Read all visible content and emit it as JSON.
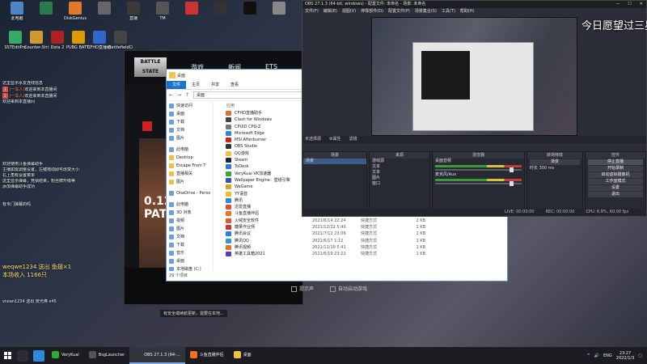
{
  "desktop_icons": [
    {
      "label": "此电脑",
      "color": "#4a86c8"
    },
    {
      "label": "",
      "color": "#2c7a4a"
    },
    {
      "label": "DiskGenius",
      "color": "#e07a2a"
    },
    {
      "label": "",
      "color": "#666"
    },
    {
      "label": "直播",
      "color": "#3a3a3a"
    },
    {
      "label": "TM",
      "color": "#555"
    },
    {
      "label": "",
      "color": "#c33"
    },
    {
      "label": "",
      "color": "#333"
    },
    {
      "label": "",
      "color": "#111"
    },
    {
      "label": "",
      "color": "#888"
    }
  ],
  "desktop_icons_row2": [
    {
      "label": "SSTEditPro",
      "color": "#3a6"
    },
    {
      "label": "Counter-Strike Global",
      "color": "#c93"
    },
    {
      "label": "Dota 2",
      "color": "#a22"
    },
    {
      "label": "PUBG BATTLEGR...",
      "color": "#d90"
    },
    {
      "label": "CFHD直播助手",
      "color": "#36c"
    },
    {
      "label": "BattlefieldCiv",
      "color": "#444"
    }
  ],
  "chat": {
    "top_lines": [
      {
        "badge": "",
        "name": "",
        "text": "这里显示水友连线信息"
      },
      {
        "badge": "3",
        "name": "(一车人)",
        "text": "欢迎来到本直播间"
      },
      {
        "badge": "2",
        "name": "(一车人)",
        "text": "欢迎来到本直播间"
      },
      {
        "badge": "",
        "name": "",
        "text": "欢迎来到本直播间"
      }
    ],
    "mid_lines": [
      "欢迎使用斗鱼弹幕助手",
      "主播如需调整设置，左键拖动即可改变大小",
      "右上角有设置菜单",
      "这里显示弹幕，竞猜结果，粉丝牌升级等",
      "添加弹幕助手成功"
    ],
    "mid_tail": "有专门弹幕的吗",
    "gift_lines": [
      "weqwe1234 送出 鱼翅×1",
      "本场收入 1166只"
    ],
    "bottom_lines": [
      "vivian1234 送出 荧光棒 x45"
    ]
  },
  "game": {
    "logo": "BATTLE STATE",
    "nav": [
      "游戏",
      "新闻",
      "ETS"
    ],
    "art_text": "0.12 PATC",
    "footer": [
      "提示声",
      "自动启动游戏"
    ]
  },
  "explorer": {
    "title": "桌面",
    "ribbon": [
      "文件",
      "主页",
      "共享",
      "查看"
    ],
    "address": "桌面",
    "sidebar": [
      {
        "label": "快速访问",
        "y": false
      },
      {
        "label": "桌面",
        "y": false
      },
      {
        "label": "下载",
        "y": false
      },
      {
        "label": "文档",
        "y": false
      },
      {
        "label": "图片",
        "y": false
      },
      {
        "label": "此电脑",
        "y": false
      },
      {
        "label": "Desktop",
        "y": true
      },
      {
        "label": "Escape From T",
        "y": true
      },
      {
        "label": "直播相关",
        "y": true
      },
      {
        "label": "图片",
        "y": true
      },
      {
        "label": "OneDrive - Perso",
        "y": false
      },
      {
        "label": "此电脑",
        "y": false
      },
      {
        "label": "3D 对象",
        "y": false
      },
      {
        "label": "视频",
        "y": false
      },
      {
        "label": "图片",
        "y": false
      },
      {
        "label": "文档",
        "y": false
      },
      {
        "label": "下载",
        "y": false
      },
      {
        "label": "音乐",
        "y": false
      },
      {
        "label": "桌面",
        "y": false
      },
      {
        "label": "本地磁盘 (C:)",
        "y": false
      },
      {
        "label": "本地磁盘 (D:)",
        "y": false
      }
    ],
    "list_header": "应用",
    "files": [
      {
        "name": "CFHD直播助手",
        "date": "",
        "type": "",
        "size": "",
        "color": "#e07030"
      },
      {
        "name": "Clash for Windows",
        "date": "",
        "type": "",
        "size": "",
        "color": "#444"
      },
      {
        "name": "CPUID CPU-Z",
        "date": "",
        "type": "",
        "size": "",
        "color": "#777"
      },
      {
        "name": "Microsoft Edge",
        "date": "",
        "type": "",
        "size": "",
        "color": "#2a8ae0"
      },
      {
        "name": "MSI Afterburner",
        "date": "",
        "type": "",
        "size": "",
        "color": "#c22"
      },
      {
        "name": "OBS Studio",
        "date": "",
        "type": "",
        "size": "",
        "color": "#333"
      },
      {
        "name": "QQ游戏",
        "date": "",
        "type": "",
        "size": "",
        "color": "#f0c040"
      },
      {
        "name": "Steam",
        "date": "",
        "type": "",
        "size": "",
        "color": "#1b2838"
      },
      {
        "name": "ToDesk",
        "date": "",
        "type": "",
        "size": "",
        "color": "#2a7ae0"
      },
      {
        "name": "VeryKuai VK加速器",
        "date": "",
        "type": "",
        "size": "",
        "color": "#3a3"
      },
      {
        "name": "Wallpaper Engine：壁纸引擎",
        "date": "",
        "type": "",
        "size": "",
        "color": "#2a5ab0"
      },
      {
        "name": "WeGame",
        "date": "",
        "type": "",
        "size": "",
        "color": "#e0a020"
      },
      {
        "name": "YY语音",
        "date": "",
        "type": "",
        "size": "",
        "color": "#f0c020"
      },
      {
        "name": "腾讯",
        "date": "",
        "type": "",
        "size": "",
        "color": "#2a8ae0"
      },
      {
        "name": "迅雷直播",
        "date": "2021/6/13 23:27",
        "type": "快捷方式",
        "size": "2 KB",
        "color": "#e05030"
      },
      {
        "name": "斗鱼直播伴侣",
        "date": "2021/12/22 23:11",
        "type": "快捷方式",
        "size": "1 KB",
        "color": "#f07020"
      },
      {
        "name": "火绒安全软件",
        "date": "2021/6/14 22:24",
        "type": "快捷方式",
        "size": "2 KB",
        "color": "#e05a30"
      },
      {
        "name": "糖果作业师",
        "date": "2021/12/22 5:40",
        "type": "快捷方式",
        "size": "1 KB",
        "color": "#c33"
      },
      {
        "name": "腾讯会议",
        "date": "2021/7/12 23:06",
        "type": "快捷方式",
        "size": "1 KB",
        "color": "#2a7ae0"
      },
      {
        "name": "腾讯QQ",
        "date": "2021/6/17 1:12",
        "type": "快捷方式",
        "size": "1 KB",
        "color": "#2a9ae0"
      },
      {
        "name": "腾讯视频",
        "date": "2021/11/19 5:41",
        "type": "快捷方式",
        "size": "1 KB",
        "color": "#f07020"
      },
      {
        "name": "英雄工具箱2021",
        "date": "2021/6/19 23:22",
        "type": "快捷方式",
        "size": "1 KB",
        "color": "#5a3ac0"
      }
    ],
    "status": "29 个项目"
  },
  "obs": {
    "title": "OBS 27.1.3 (64-bit, windows) - 配置文件: 未命名 - 场景: 未命名",
    "menu": [
      "文件(F)",
      "编辑(E)",
      "视图(V)",
      "停靠部件(D)",
      "配置文件(P)",
      "场景集合(S)",
      "工具(T)",
      "帮助(H)"
    ],
    "caption": "今日愿望过三星✈",
    "strip": [
      "未选择源",
      "⚙属性",
      "滤镜"
    ],
    "scenes_header": "场景",
    "scenes": [
      "场景"
    ],
    "sources_header": "来源",
    "sources": [
      "游戏源",
      "文本",
      "文本",
      "图片",
      "窗口"
    ],
    "mixer_header": "混音器",
    "mixer": [
      "桌面音频",
      "麦克风/Aux"
    ],
    "transitions_header": "转场特效",
    "transition_type": "渐变",
    "transition_duration_label": "时长",
    "transition_duration": "300 ms",
    "controls_header": "控件",
    "controls": [
      "停止直播",
      "开始录制",
      "启动虚拟摄像机",
      "工作室模式",
      "设置",
      "退出"
    ],
    "status": [
      "LIVE: 00:00:00",
      "REC: 00:00:00",
      "CPU: 6.9%, 60.00 fps"
    ]
  },
  "launcher_toast": "有安全或续航更新，需要在本地...",
  "taskbar": {
    "apps": [
      {
        "label": "VeryKuai",
        "color": "#3a3",
        "active": false
      },
      {
        "label": "BsgLauncher",
        "color": "#555",
        "active": false
      },
      {
        "label": "OBS 27.1.3 (64-...",
        "color": "#333",
        "active": true
      },
      {
        "label": "斗鱼直播伴侣",
        "color": "#f07020",
        "active": false
      },
      {
        "label": "桌面",
        "color": "#f0c040",
        "active": false
      }
    ],
    "tray_lang": "ENG",
    "time": "23:27",
    "date": "2022/1/3"
  }
}
